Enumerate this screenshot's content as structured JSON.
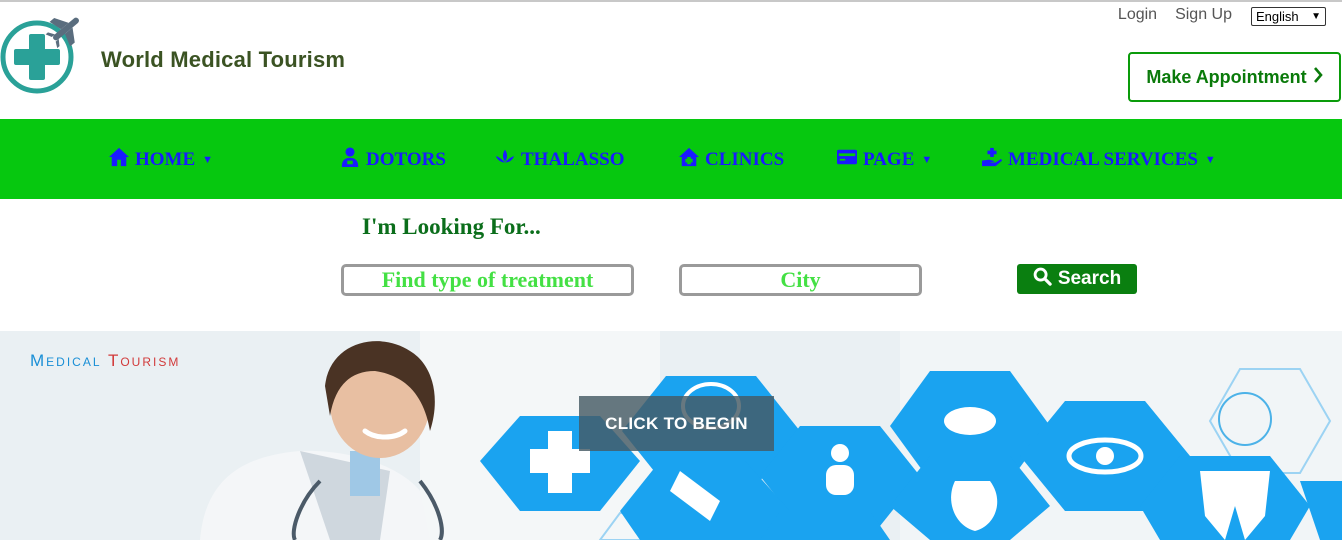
{
  "header": {
    "brand": "World Medical Tourism",
    "login_label": "Login",
    "signup_label": "Sign Up",
    "language_selected": "English",
    "appointment_label": "Make Appointment"
  },
  "nav": {
    "items": [
      {
        "label": "HOME",
        "icon": "home-icon",
        "dropdown": true
      },
      {
        "label": "DOTORS",
        "icon": "doctor-icon",
        "dropdown": false
      },
      {
        "label": "THALASSO",
        "icon": "lotus-icon",
        "dropdown": false
      },
      {
        "label": "CLINICS",
        "icon": "clinic-icon",
        "dropdown": false
      },
      {
        "label": "PAGE",
        "icon": "card-icon",
        "dropdown": true
      },
      {
        "label": "MEDICAL SERVICES",
        "icon": "hand-medical-icon",
        "dropdown": true
      }
    ]
  },
  "search": {
    "heading": "I'm Looking For...",
    "treatment_placeholder": "Find type of treatment",
    "city_placeholder": "City",
    "button_label": "Search"
  },
  "hero": {
    "label_first": "Medical",
    "label_second": "Tourism",
    "cta_label": "CLICK TO BEGIN"
  },
  "colors": {
    "nav_bg": "#06c80f",
    "nav_text": "#1a1aff",
    "brand": "#3b5323",
    "search_button": "#0a7f10",
    "placeholder_text": "#44e044",
    "hex_blue": "#1aa3f0"
  }
}
